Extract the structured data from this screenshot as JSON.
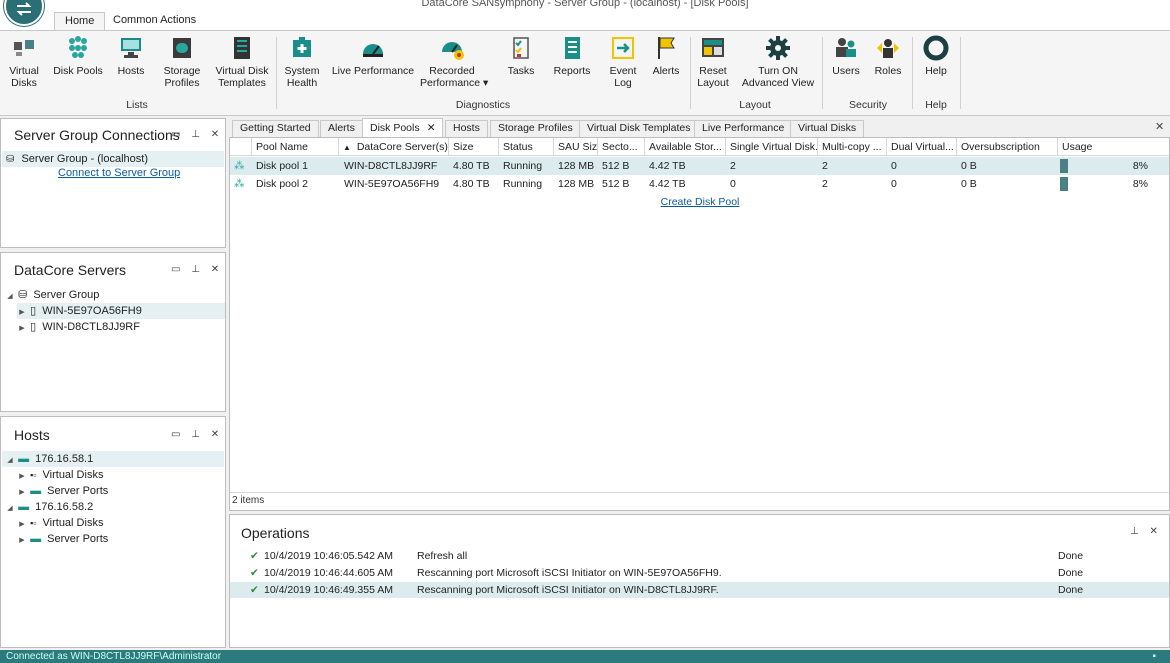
{
  "window": {
    "title": "DataCore SANsymphony - Server Group - (localhost) - [Disk Pools]"
  },
  "ribbon_tabs": [
    {
      "label": "Home",
      "active": true
    },
    {
      "label": "Common Actions",
      "active": false
    }
  ],
  "ribbon": {
    "buttons": [
      {
        "label": "Virtual\nDisks",
        "icon": "virtual-disks-icon"
      },
      {
        "label": "Disk Pools",
        "icon": "disk-pools-icon"
      },
      {
        "label": "Hosts",
        "icon": "hosts-icon"
      },
      {
        "label": "Storage\nProfiles",
        "icon": "storage-profiles-icon"
      },
      {
        "label": "Virtual Disk\nTemplates",
        "icon": "virtual-disk-templates-icon"
      },
      {
        "label": "System\nHealth",
        "icon": "system-health-icon"
      },
      {
        "label": "Live Performance",
        "icon": "live-performance-icon"
      },
      {
        "label": "Recorded\nPerformance ▾",
        "icon": "recorded-performance-icon"
      },
      {
        "label": "Tasks",
        "icon": "tasks-icon"
      },
      {
        "label": "Reports",
        "icon": "reports-icon"
      },
      {
        "label": "Event\nLog",
        "icon": "event-log-icon"
      },
      {
        "label": "Alerts",
        "icon": "alerts-flag-icon"
      },
      {
        "label": "Reset\nLayout",
        "icon": "reset-layout-icon"
      },
      {
        "label": "Turn ON\nAdvanced View",
        "icon": "advanced-view-gear-icon"
      },
      {
        "label": "Users",
        "icon": "users-icon"
      },
      {
        "label": "Roles",
        "icon": "roles-icon"
      },
      {
        "label": "Help",
        "icon": "help-lifebuoy-icon"
      }
    ],
    "groups": [
      "Lists",
      "Diagnostics",
      "Layout",
      "Security",
      "Help"
    ]
  },
  "server_group_panel": {
    "title": "Server Group Connections",
    "item": "Server Group - (localhost)",
    "link": "Connect to Server Group"
  },
  "datacore_servers_panel": {
    "title": "DataCore Servers",
    "group": "Server Group",
    "servers": [
      "WIN-5E97OA56FH9",
      "WIN-D8CTL8JJ9RF"
    ]
  },
  "hosts_panel": {
    "title": "Hosts",
    "hosts": [
      {
        "name": "176.16.58.1",
        "children": [
          "Virtual Disks",
          "Server Ports"
        ]
      },
      {
        "name": "176.16.58.2",
        "children": [
          "Virtual Disks",
          "Server Ports"
        ]
      }
    ]
  },
  "doc_tabs": [
    "Getting Started",
    "Alerts",
    "Disk Pools",
    "Hosts",
    "Storage Profiles",
    "Virtual Disk Templates",
    "Live Performance",
    "Virtual Disks"
  ],
  "active_doc_tab": "Disk Pools",
  "grid": {
    "columns": [
      "Pool Name",
      "DataCore Server(s)",
      "Size",
      "Status",
      "SAU Size",
      "Secto...",
      "Available Stor...",
      "Single Virtual Disk...",
      "Multi-copy ...",
      "Dual Virtual...",
      "Oversubscription",
      "Usage"
    ],
    "rows": [
      {
        "name": "Disk pool 1",
        "server": "WIN-D8CTL8JJ9RF",
        "size": "4.80 TB",
        "status": "Running",
        "sau": "128 MB",
        "sector": "512 B",
        "available": "4.42 TB",
        "single": "2",
        "multi": "2",
        "dual": "0",
        "over": "0 B",
        "usage": "8%",
        "usage_fraction": 0.08
      },
      {
        "name": "Disk pool 2",
        "server": "WIN-5E97OA56FH9",
        "size": "4.80 TB",
        "status": "Running",
        "sau": "128 MB",
        "sector": "512 B",
        "available": "4.42 TB",
        "single": "0",
        "multi": "2",
        "dual": "0",
        "over": "0 B",
        "usage": "8%",
        "usage_fraction": 0.08
      }
    ],
    "create_link": "Create Disk Pool",
    "footer": "2 items"
  },
  "operations": {
    "title": "Operations",
    "rows": [
      {
        "time": "10/4/2019 10:46:05.542 AM",
        "message": "Refresh all",
        "state": "Done"
      },
      {
        "time": "10/4/2019 10:46:44.605 AM",
        "message": "Rescanning port Microsoft iSCSI Initiator on WIN-5E97OA56FH9.",
        "state": "Done"
      },
      {
        "time": "10/4/2019 10:46:49.355 AM",
        "message": "Rescanning port Microsoft iSCSI Initiator on WIN-D8CTL8JJ9RF.",
        "state": "Done"
      }
    ]
  },
  "status_bar": {
    "text": "Connected as WIN-D8CTL8JJ9RF\\Administrator"
  },
  "colors": {
    "accent": "#2b7b7e",
    "selection": "#dcecee",
    "link": "#0c5a9e"
  }
}
